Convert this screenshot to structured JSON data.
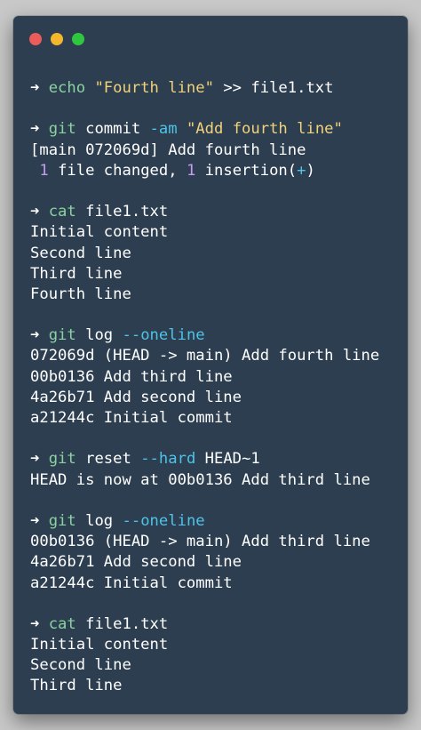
{
  "colors": {
    "window_bg": "#2d3e50",
    "close": "#ee5b5b",
    "minimize": "#f5b62e",
    "maximize": "#2fc640",
    "prompt": "#ffffff",
    "command": "#8ad2a0",
    "flag": "#4ec3e8",
    "string": "#f0d27a",
    "number": "#c79bf2",
    "text": "#ffffff"
  },
  "window_controls": [
    "close-light",
    "minimize-light",
    "maximize-light"
  ],
  "blocks": [
    {
      "lines": [
        {
          "segments": [
            {
              "t": "➜ ",
              "c": "prompt"
            },
            {
              "t": "echo ",
              "c": "command"
            },
            {
              "t": "\"Fourth line\"",
              "c": "string"
            },
            {
              "t": " >> file1.txt",
              "c": "text"
            }
          ]
        }
      ]
    },
    {
      "lines": [
        {
          "segments": [
            {
              "t": "➜ ",
              "c": "prompt"
            },
            {
              "t": "git ",
              "c": "command"
            },
            {
              "t": "commit ",
              "c": "text"
            },
            {
              "t": "-am ",
              "c": "flag"
            },
            {
              "t": "\"Add fourth line\"",
              "c": "string"
            }
          ]
        },
        {
          "segments": [
            {
              "t": "[main 072069d] Add fourth line",
              "c": "text"
            }
          ]
        },
        {
          "segments": [
            {
              "t": " ",
              "c": "text"
            },
            {
              "t": "1",
              "c": "number"
            },
            {
              "t": " file changed, ",
              "c": "text"
            },
            {
              "t": "1",
              "c": "number"
            },
            {
              "t": " insertion(",
              "c": "text"
            },
            {
              "t": "+",
              "c": "flag"
            },
            {
              "t": ")",
              "c": "text"
            }
          ]
        }
      ]
    },
    {
      "lines": [
        {
          "segments": [
            {
              "t": "➜ ",
              "c": "prompt"
            },
            {
              "t": "cat ",
              "c": "command"
            },
            {
              "t": "file1.txt",
              "c": "text"
            }
          ]
        },
        {
          "segments": [
            {
              "t": "Initial content",
              "c": "text"
            }
          ]
        },
        {
          "segments": [
            {
              "t": "Second line",
              "c": "text"
            }
          ]
        },
        {
          "segments": [
            {
              "t": "Third line",
              "c": "text"
            }
          ]
        },
        {
          "segments": [
            {
              "t": "Fourth line",
              "c": "text"
            }
          ]
        }
      ]
    },
    {
      "lines": [
        {
          "segments": [
            {
              "t": "➜ ",
              "c": "prompt"
            },
            {
              "t": "git ",
              "c": "command"
            },
            {
              "t": "log ",
              "c": "text"
            },
            {
              "t": "--oneline",
              "c": "flag"
            }
          ]
        },
        {
          "segments": [
            {
              "t": "072069d (HEAD -> main) Add fourth line",
              "c": "text"
            }
          ]
        },
        {
          "segments": [
            {
              "t": "00b0136 Add third line",
              "c": "text"
            }
          ]
        },
        {
          "segments": [
            {
              "t": "4a26b71 Add second line",
              "c": "text"
            }
          ]
        },
        {
          "segments": [
            {
              "t": "a21244c Initial commit",
              "c": "text"
            }
          ]
        }
      ]
    },
    {
      "lines": [
        {
          "segments": [
            {
              "t": "➜ ",
              "c": "prompt"
            },
            {
              "t": "git ",
              "c": "command"
            },
            {
              "t": "reset ",
              "c": "text"
            },
            {
              "t": "--hard ",
              "c": "flag"
            },
            {
              "t": "HEAD~1",
              "c": "text"
            }
          ]
        },
        {
          "segments": [
            {
              "t": "HEAD is now at 00b0136 Add third line",
              "c": "text"
            }
          ]
        }
      ]
    },
    {
      "lines": [
        {
          "segments": [
            {
              "t": "➜ ",
              "c": "prompt"
            },
            {
              "t": "git ",
              "c": "command"
            },
            {
              "t": "log ",
              "c": "text"
            },
            {
              "t": "--oneline",
              "c": "flag"
            }
          ]
        },
        {
          "segments": [
            {
              "t": "00b0136 (HEAD -> main) Add third line",
              "c": "text"
            }
          ]
        },
        {
          "segments": [
            {
              "t": "4a26b71 Add second line",
              "c": "text"
            }
          ]
        },
        {
          "segments": [
            {
              "t": "a21244c Initial commit",
              "c": "text"
            }
          ]
        }
      ]
    },
    {
      "lines": [
        {
          "segments": [
            {
              "t": "➜ ",
              "c": "prompt"
            },
            {
              "t": "cat ",
              "c": "command"
            },
            {
              "t": "file1.txt",
              "c": "text"
            }
          ]
        },
        {
          "segments": [
            {
              "t": "Initial content",
              "c": "text"
            }
          ]
        },
        {
          "segments": [
            {
              "t": "Second line",
              "c": "text"
            }
          ]
        },
        {
          "segments": [
            {
              "t": "Third line",
              "c": "text"
            }
          ]
        }
      ]
    }
  ]
}
